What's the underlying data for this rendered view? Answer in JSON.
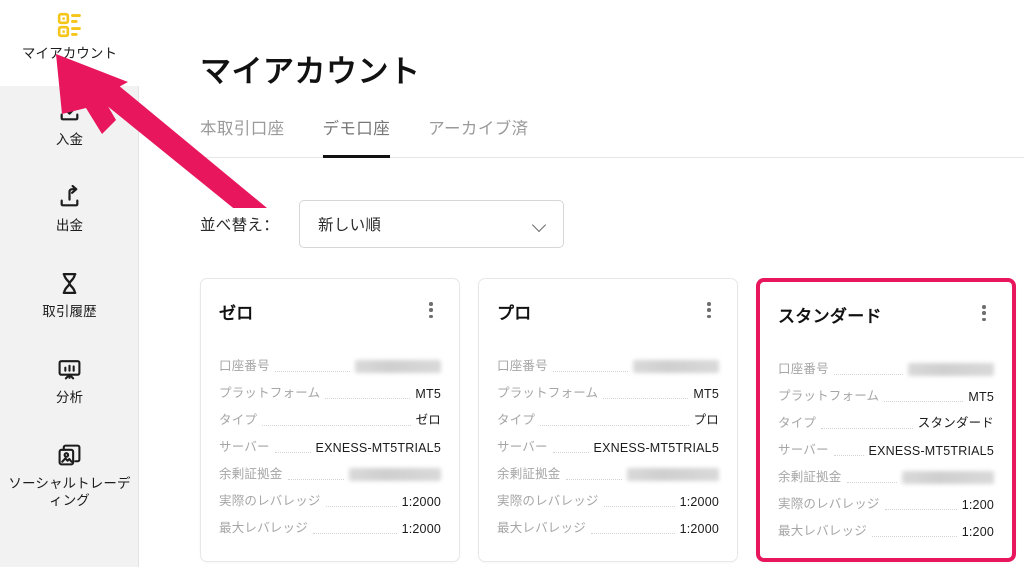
{
  "brand": {
    "accent_pink": "#e8175d",
    "accent_yellow": "#f5c518"
  },
  "sidebar": {
    "items": [
      {
        "label": "マイアカウント",
        "icon": "grid-accounts-icon",
        "active": true
      },
      {
        "label": "入金",
        "icon": "download-deposit-icon",
        "active": false
      },
      {
        "label": "出金",
        "icon": "upload-withdraw-icon",
        "active": false
      },
      {
        "label": "取引履歴",
        "icon": "hourglass-history-icon",
        "active": false
      },
      {
        "label": "分析",
        "icon": "chart-board-analytics-icon",
        "active": false
      },
      {
        "label": "ソーシャルトレーディング",
        "icon": "copy-social-trading-icon",
        "active": false
      }
    ]
  },
  "header": {
    "title": "マイアカウント"
  },
  "tabs": [
    {
      "label": "本取引口座",
      "active": false
    },
    {
      "label": "デモ口座",
      "active": true
    },
    {
      "label": "アーカイブ済",
      "active": false
    }
  ],
  "sort": {
    "label": "並べ替え：",
    "value": "新しい順",
    "chevron": "chevron-down-icon"
  },
  "field_labels": {
    "account_number": "口座番号",
    "platform": "プラットフォーム",
    "type": "タイプ",
    "server": "サーバー",
    "free_margin": "余剰証拠金",
    "actual_leverage": "実際のレバレッジ",
    "max_leverage": "最大レバレッジ"
  },
  "cards": [
    {
      "title": "ゼロ",
      "menu_icon": "kebab-menu-icon",
      "highlighted": false,
      "account_number": "",
      "account_number_masked": true,
      "platform": "MT5",
      "type": "ゼロ",
      "server": "EXNESS-MT5TRIAL5",
      "free_margin": "",
      "free_margin_masked": true,
      "actual_leverage": "1:2000",
      "max_leverage": "1:2000"
    },
    {
      "title": "プロ",
      "menu_icon": "kebab-menu-icon",
      "highlighted": false,
      "account_number": "",
      "account_number_masked": true,
      "platform": "MT5",
      "type": "プロ",
      "server": "EXNESS-MT5TRIAL5",
      "free_margin": "",
      "free_margin_masked": true,
      "actual_leverage": "1:2000",
      "max_leverage": "1:2000"
    },
    {
      "title": "スタンダード",
      "menu_icon": "kebab-menu-icon",
      "highlighted": true,
      "account_number": "",
      "account_number_masked": true,
      "platform": "MT5",
      "type": "スタンダード",
      "server": "EXNESS-MT5TRIAL5",
      "free_margin": "",
      "free_margin_masked": true,
      "actual_leverage": "1:200",
      "max_leverage": "1:200"
    }
  ],
  "annotation": {
    "arrow_color": "#e8175d",
    "arrow_points_to": "sidebar-item-my-account"
  }
}
